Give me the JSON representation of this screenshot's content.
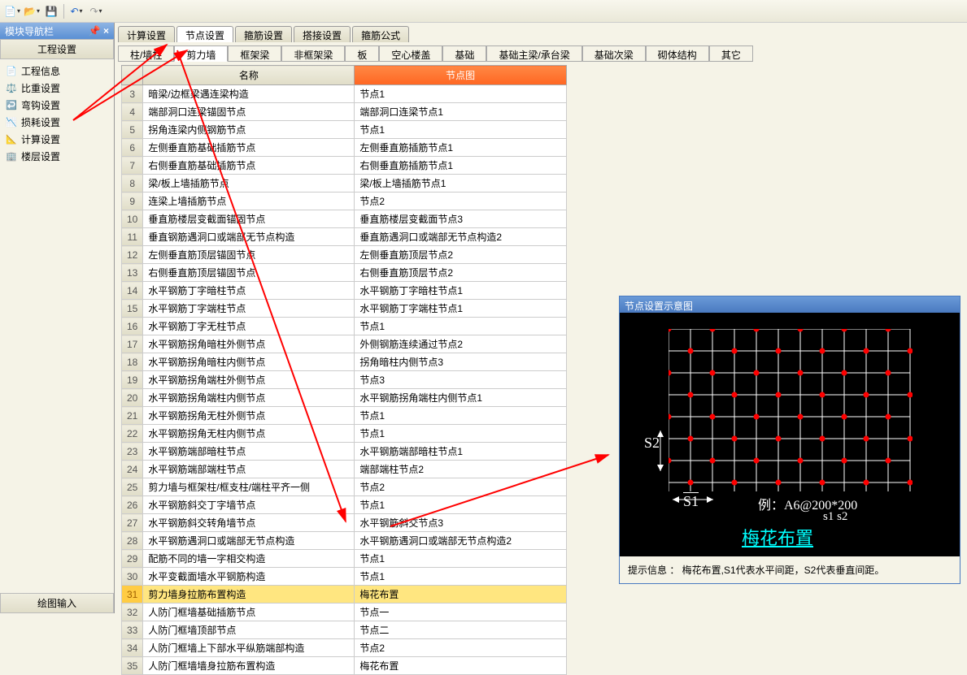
{
  "leftPanel": {
    "title": "模块导航栏",
    "section1": "工程设置",
    "section2": "绘图输入",
    "items": [
      {
        "label": "工程信息",
        "icon": "📄"
      },
      {
        "label": "比重设置",
        "icon": "⚖️"
      },
      {
        "label": "弯钩设置",
        "icon": "↩️"
      },
      {
        "label": "损耗设置",
        "icon": "📉"
      },
      {
        "label": "计算设置",
        "icon": "📐"
      },
      {
        "label": "楼层设置",
        "icon": "🏢"
      }
    ]
  },
  "tabs1": [
    "计算设置",
    "节点设置",
    "箍筋设置",
    "搭接设置",
    "箍筋公式"
  ],
  "tabs1_active": 1,
  "tabs2": [
    "柱/墙柱",
    "剪力墙",
    "框架梁",
    "非框架梁",
    "板",
    "空心楼盖",
    "基础",
    "基础主梁/承台梁",
    "基础次梁",
    "砌体结构",
    "其它"
  ],
  "tabs2_active": 1,
  "headers": {
    "col1": "名称",
    "col2": "节点图"
  },
  "rows": [
    {
      "n": 3,
      "name": "暗梁/边框梁遇连梁构造",
      "node": "节点1"
    },
    {
      "n": 4,
      "name": "端部洞口连梁锚固节点",
      "node": "端部洞口连梁节点1"
    },
    {
      "n": 5,
      "name": "拐角连梁内侧钢筋节点",
      "node": "节点1"
    },
    {
      "n": 6,
      "name": "左侧垂直筋基础插筋节点",
      "node": "左侧垂直筋插筋节点1"
    },
    {
      "n": 7,
      "name": "右侧垂直筋基础插筋节点",
      "node": "右侧垂直筋插筋节点1"
    },
    {
      "n": 8,
      "name": "梁/板上墙插筋节点",
      "node": "梁/板上墙插筋节点1"
    },
    {
      "n": 9,
      "name": "连梁上墙插筋节点",
      "node": "节点2"
    },
    {
      "n": 10,
      "name": "垂直筋楼层变截面锚固节点",
      "node": "垂直筋楼层变截面节点3"
    },
    {
      "n": 11,
      "name": "垂直钢筋遇洞口或端部无节点构造",
      "node": "垂直筋遇洞口或端部无节点构造2"
    },
    {
      "n": 12,
      "name": "左侧垂直筋顶层锚固节点",
      "node": "左侧垂直筋顶层节点2"
    },
    {
      "n": 13,
      "name": "右侧垂直筋顶层锚固节点",
      "node": "右侧垂直筋顶层节点2"
    },
    {
      "n": 14,
      "name": "水平钢筋丁字暗柱节点",
      "node": "水平钢筋丁字暗柱节点1"
    },
    {
      "n": 15,
      "name": "水平钢筋丁字端柱节点",
      "node": "水平钢筋丁字端柱节点1"
    },
    {
      "n": 16,
      "name": "水平钢筋丁字无柱节点",
      "node": "节点1"
    },
    {
      "n": 17,
      "name": "水平钢筋拐角暗柱外侧节点",
      "node": "外侧钢筋连续通过节点2"
    },
    {
      "n": 18,
      "name": "水平钢筋拐角暗柱内侧节点",
      "node": "拐角暗柱内侧节点3"
    },
    {
      "n": 19,
      "name": "水平钢筋拐角端柱外侧节点",
      "node": "节点3"
    },
    {
      "n": 20,
      "name": "水平钢筋拐角端柱内侧节点",
      "node": "水平钢筋拐角端柱内侧节点1"
    },
    {
      "n": 21,
      "name": "水平钢筋拐角无柱外侧节点",
      "node": "节点1"
    },
    {
      "n": 22,
      "name": "水平钢筋拐角无柱内侧节点",
      "node": "节点1"
    },
    {
      "n": 23,
      "name": "水平钢筋端部暗柱节点",
      "node": "水平钢筋端部暗柱节点1"
    },
    {
      "n": 24,
      "name": "水平钢筋端部端柱节点",
      "node": "端部端柱节点2"
    },
    {
      "n": 25,
      "name": "剪力墙与框架柱/框支柱/端柱平齐一侧",
      "node": "节点2"
    },
    {
      "n": 26,
      "name": "水平钢筋斜交丁字墙节点",
      "node": "节点1"
    },
    {
      "n": 27,
      "name": "水平钢筋斜交转角墙节点",
      "node": "水平钢筋斜交节点3"
    },
    {
      "n": 28,
      "name": "水平钢筋遇洞口或端部无节点构造",
      "node": "水平钢筋遇洞口或端部无节点构造2"
    },
    {
      "n": 29,
      "name": "配筋不同的墙一字相交构造",
      "node": "节点1"
    },
    {
      "n": 30,
      "name": "水平变截面墙水平钢筋构造",
      "node": "节点1"
    },
    {
      "n": 31,
      "name": "剪力墙身拉筋布置构造",
      "node": "梅花布置",
      "selected": true
    },
    {
      "n": 32,
      "name": "人防门框墙基础插筋节点",
      "node": "节点一"
    },
    {
      "n": 33,
      "name": "人防门框墙顶部节点",
      "node": "节点二"
    },
    {
      "n": 34,
      "name": "人防门框墙上下部水平纵筋端部构造",
      "node": "节点2"
    },
    {
      "n": 35,
      "name": "人防门框墙墙身拉筋布置构造",
      "node": "梅花布置"
    }
  ],
  "preview": {
    "title": "节点设置示意图",
    "s1": "S1",
    "s2": "S2",
    "example": "例：A6@200*200",
    "sub": "s1    s2",
    "link": "梅花布置",
    "hint": "提示信息 ： 梅花布置,S1代表水平间距，S2代表垂直间距。"
  }
}
